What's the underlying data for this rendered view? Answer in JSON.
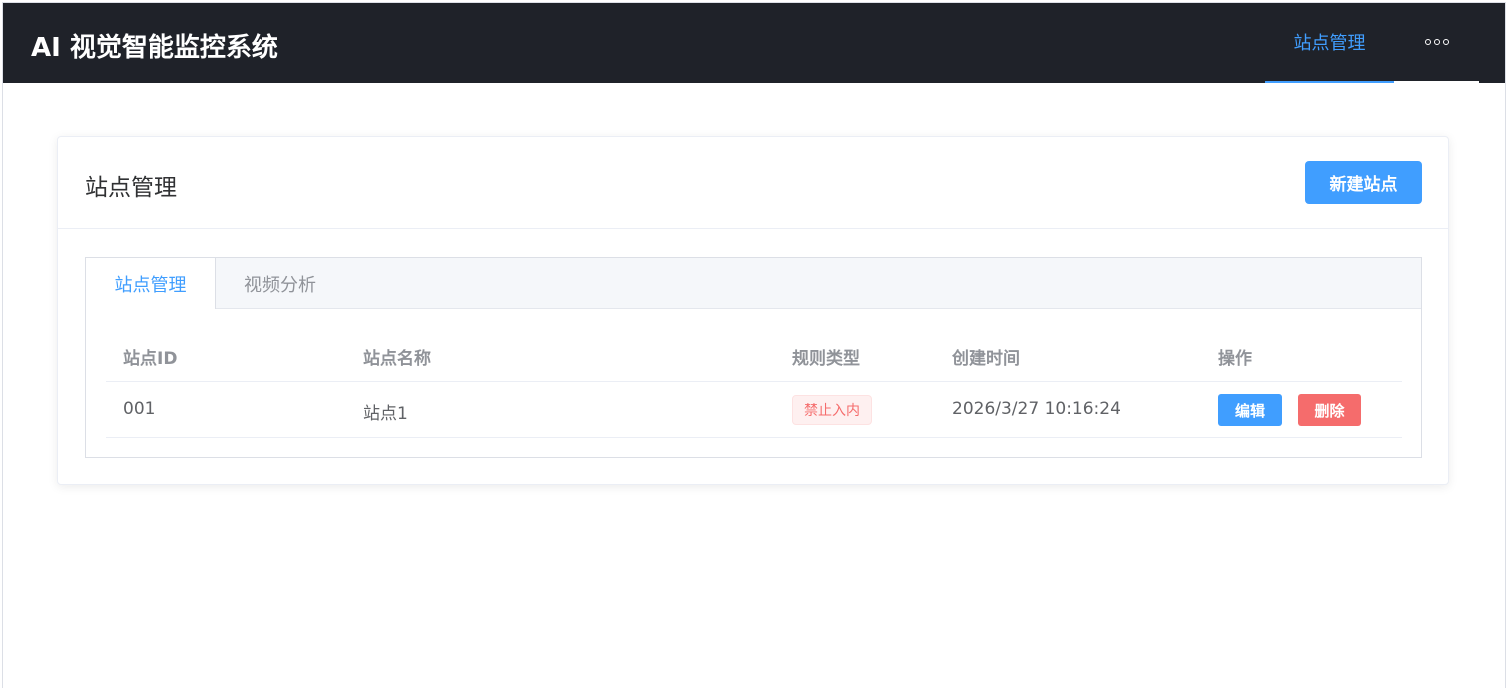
{
  "header": {
    "app_title": "AI 视觉智能监控系统",
    "nav_items": [
      {
        "label": "站点管理",
        "active": true
      }
    ],
    "more_icon": "more-horizontal-icon"
  },
  "card": {
    "title": "站点管理",
    "new_button_label": "新建站点"
  },
  "tabs": [
    {
      "label": "站点管理",
      "active": true
    },
    {
      "label": "视频分析",
      "active": false
    }
  ],
  "table": {
    "columns": [
      "站点ID",
      "站点名称",
      "规则类型",
      "创建时间",
      "操作"
    ],
    "rows": [
      {
        "id": "001",
        "name": "站点1",
        "rule_type": "禁止入内",
        "created_at": "2026/3/27 10:16:24",
        "actions": {
          "edit": "编辑",
          "delete": "删除"
        }
      }
    ]
  },
  "colors": {
    "topbar_bg": "#1f2229",
    "primary": "#409eff",
    "danger": "#f56c6c"
  }
}
